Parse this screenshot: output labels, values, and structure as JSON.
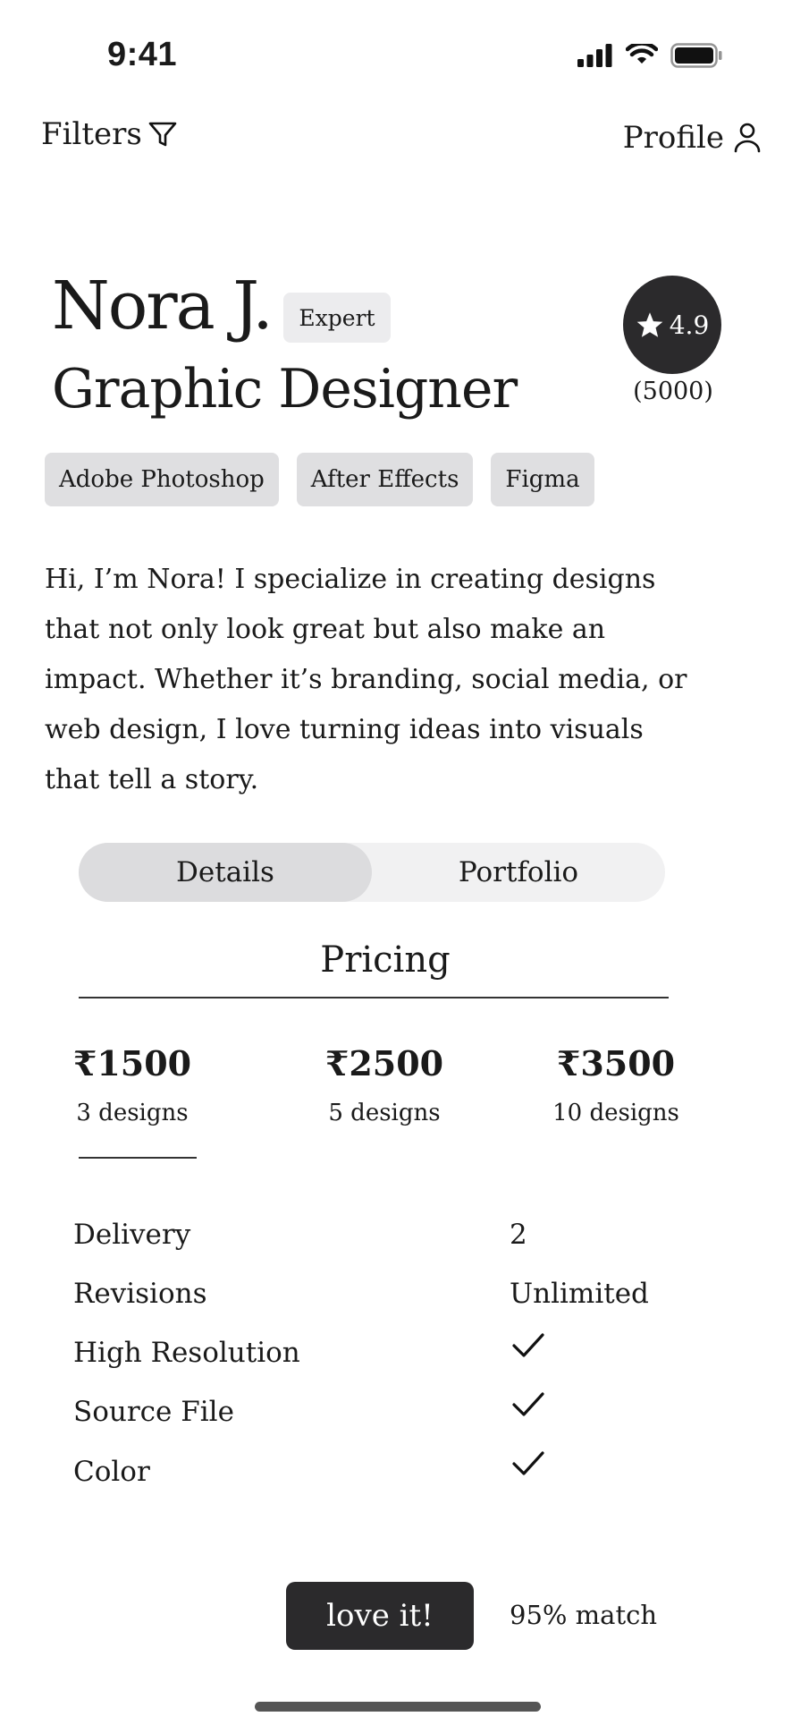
{
  "status_bar": {
    "time": "9:41"
  },
  "topbar": {
    "filters_label": "Filters",
    "profile_label": "Profile"
  },
  "profile": {
    "name": "Nora J.",
    "level": "Expert",
    "title": "Graphic Designer",
    "rating": "4.9",
    "rating_count": "(5000)",
    "skills": [
      "Adobe Photoshop",
      "After Effects",
      "Figma"
    ],
    "bio": "Hi, I’m Nora! I specialize in creating designs that not only look great but also make an impact. Whether it’s branding, social media, or web design, I love turning ideas into visuals that tell a story."
  },
  "tabs": {
    "items": [
      "Details",
      "Portfolio"
    ],
    "selected": "Details"
  },
  "pricing": {
    "title": "Pricing",
    "tiers": [
      {
        "price": "₹1500",
        "count": "3 designs"
      },
      {
        "price": "₹2500",
        "count": "5 designs"
      },
      {
        "price": "₹3500",
        "count": "10 designs"
      }
    ],
    "selected_tier": "₹1500"
  },
  "features": [
    {
      "label": "Delivery",
      "value": "2"
    },
    {
      "label": "Revisions",
      "value": "Unlimited"
    },
    {
      "label": "High Resolution",
      "value": "check-icon"
    },
    {
      "label": "Source File",
      "value": "check-icon"
    },
    {
      "label": "Color",
      "value": "check-icon"
    }
  ],
  "cta": {
    "label": "love it!",
    "match": "95% match"
  },
  "colors": {
    "dark": "#2b2a2c",
    "chip": "#dfdfe1",
    "segment": "#f1f1f2"
  }
}
